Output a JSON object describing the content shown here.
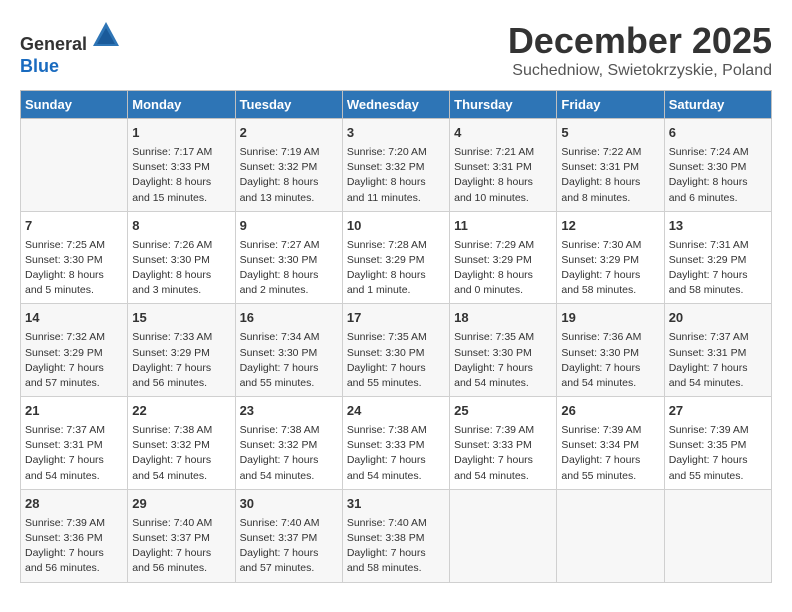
{
  "logo": {
    "general": "General",
    "blue": "Blue"
  },
  "title": {
    "month": "December 2025",
    "location": "Suchedniow, Swietokrzyskie, Poland"
  },
  "headers": [
    "Sunday",
    "Monday",
    "Tuesday",
    "Wednesday",
    "Thursday",
    "Friday",
    "Saturday"
  ],
  "weeks": [
    [
      {
        "day": "",
        "info": ""
      },
      {
        "day": "1",
        "info": "Sunrise: 7:17 AM\nSunset: 3:33 PM\nDaylight: 8 hours\nand 15 minutes."
      },
      {
        "day": "2",
        "info": "Sunrise: 7:19 AM\nSunset: 3:32 PM\nDaylight: 8 hours\nand 13 minutes."
      },
      {
        "day": "3",
        "info": "Sunrise: 7:20 AM\nSunset: 3:32 PM\nDaylight: 8 hours\nand 11 minutes."
      },
      {
        "day": "4",
        "info": "Sunrise: 7:21 AM\nSunset: 3:31 PM\nDaylight: 8 hours\nand 10 minutes."
      },
      {
        "day": "5",
        "info": "Sunrise: 7:22 AM\nSunset: 3:31 PM\nDaylight: 8 hours\nand 8 minutes."
      },
      {
        "day": "6",
        "info": "Sunrise: 7:24 AM\nSunset: 3:30 PM\nDaylight: 8 hours\nand 6 minutes."
      }
    ],
    [
      {
        "day": "7",
        "info": "Sunrise: 7:25 AM\nSunset: 3:30 PM\nDaylight: 8 hours\nand 5 minutes."
      },
      {
        "day": "8",
        "info": "Sunrise: 7:26 AM\nSunset: 3:30 PM\nDaylight: 8 hours\nand 3 minutes."
      },
      {
        "day": "9",
        "info": "Sunrise: 7:27 AM\nSunset: 3:30 PM\nDaylight: 8 hours\nand 2 minutes."
      },
      {
        "day": "10",
        "info": "Sunrise: 7:28 AM\nSunset: 3:29 PM\nDaylight: 8 hours\nand 1 minute."
      },
      {
        "day": "11",
        "info": "Sunrise: 7:29 AM\nSunset: 3:29 PM\nDaylight: 8 hours\nand 0 minutes."
      },
      {
        "day": "12",
        "info": "Sunrise: 7:30 AM\nSunset: 3:29 PM\nDaylight: 7 hours\nand 58 minutes."
      },
      {
        "day": "13",
        "info": "Sunrise: 7:31 AM\nSunset: 3:29 PM\nDaylight: 7 hours\nand 58 minutes."
      }
    ],
    [
      {
        "day": "14",
        "info": "Sunrise: 7:32 AM\nSunset: 3:29 PM\nDaylight: 7 hours\nand 57 minutes."
      },
      {
        "day": "15",
        "info": "Sunrise: 7:33 AM\nSunset: 3:29 PM\nDaylight: 7 hours\nand 56 minutes."
      },
      {
        "day": "16",
        "info": "Sunrise: 7:34 AM\nSunset: 3:30 PM\nDaylight: 7 hours\nand 55 minutes."
      },
      {
        "day": "17",
        "info": "Sunrise: 7:35 AM\nSunset: 3:30 PM\nDaylight: 7 hours\nand 55 minutes."
      },
      {
        "day": "18",
        "info": "Sunrise: 7:35 AM\nSunset: 3:30 PM\nDaylight: 7 hours\nand 54 minutes."
      },
      {
        "day": "19",
        "info": "Sunrise: 7:36 AM\nSunset: 3:30 PM\nDaylight: 7 hours\nand 54 minutes."
      },
      {
        "day": "20",
        "info": "Sunrise: 7:37 AM\nSunset: 3:31 PM\nDaylight: 7 hours\nand 54 minutes."
      }
    ],
    [
      {
        "day": "21",
        "info": "Sunrise: 7:37 AM\nSunset: 3:31 PM\nDaylight: 7 hours\nand 54 minutes."
      },
      {
        "day": "22",
        "info": "Sunrise: 7:38 AM\nSunset: 3:32 PM\nDaylight: 7 hours\nand 54 minutes."
      },
      {
        "day": "23",
        "info": "Sunrise: 7:38 AM\nSunset: 3:32 PM\nDaylight: 7 hours\nand 54 minutes."
      },
      {
        "day": "24",
        "info": "Sunrise: 7:38 AM\nSunset: 3:33 PM\nDaylight: 7 hours\nand 54 minutes."
      },
      {
        "day": "25",
        "info": "Sunrise: 7:39 AM\nSunset: 3:33 PM\nDaylight: 7 hours\nand 54 minutes."
      },
      {
        "day": "26",
        "info": "Sunrise: 7:39 AM\nSunset: 3:34 PM\nDaylight: 7 hours\nand 55 minutes."
      },
      {
        "day": "27",
        "info": "Sunrise: 7:39 AM\nSunset: 3:35 PM\nDaylight: 7 hours\nand 55 minutes."
      }
    ],
    [
      {
        "day": "28",
        "info": "Sunrise: 7:39 AM\nSunset: 3:36 PM\nDaylight: 7 hours\nand 56 minutes."
      },
      {
        "day": "29",
        "info": "Sunrise: 7:40 AM\nSunset: 3:37 PM\nDaylight: 7 hours\nand 56 minutes."
      },
      {
        "day": "30",
        "info": "Sunrise: 7:40 AM\nSunset: 3:37 PM\nDaylight: 7 hours\nand 57 minutes."
      },
      {
        "day": "31",
        "info": "Sunrise: 7:40 AM\nSunset: 3:38 PM\nDaylight: 7 hours\nand 58 minutes."
      },
      {
        "day": "",
        "info": ""
      },
      {
        "day": "",
        "info": ""
      },
      {
        "day": "",
        "info": ""
      }
    ]
  ]
}
